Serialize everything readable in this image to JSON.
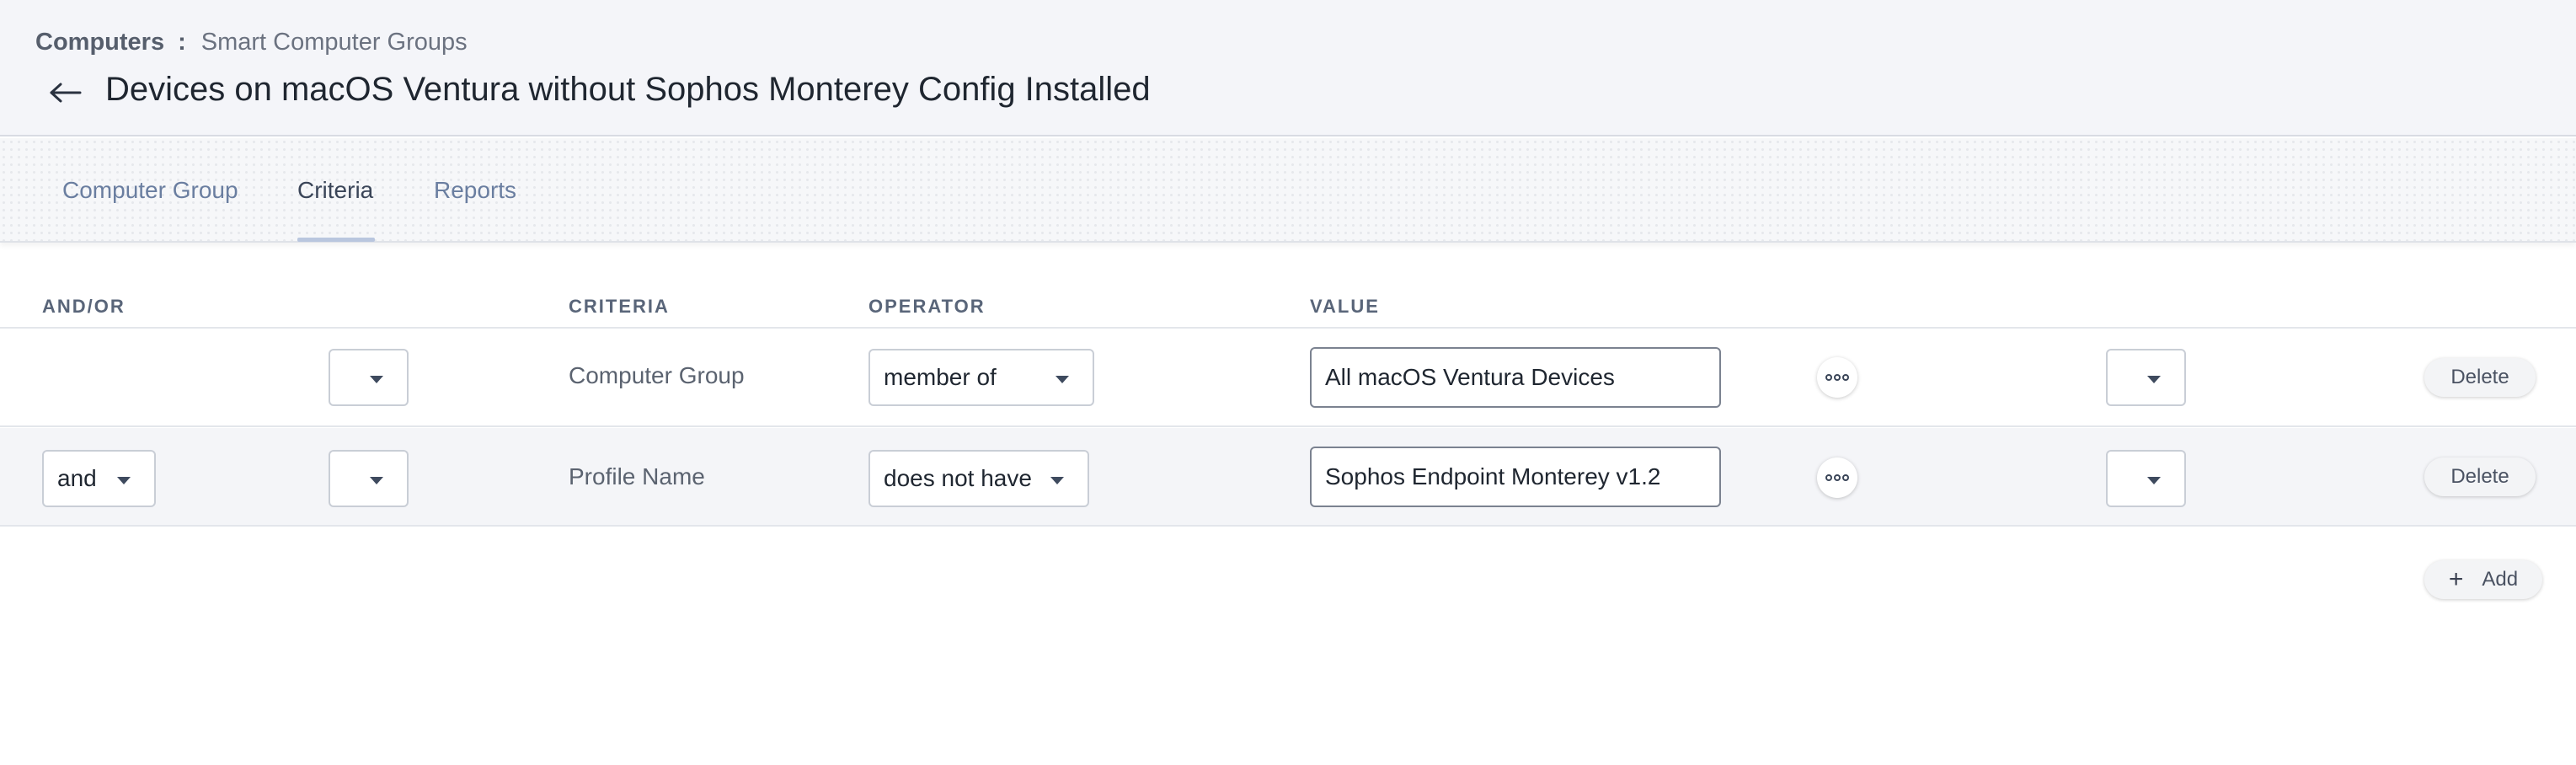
{
  "breadcrumb": {
    "root": "Computers",
    "separator": ":",
    "current": "Smart Computer Groups"
  },
  "page": {
    "title": "Devices on macOS Ventura without Sophos Monterey Config Installed",
    "back_icon": "arrow-left-icon"
  },
  "tabs": [
    {
      "label": "Computer Group",
      "active": false
    },
    {
      "label": "Criteria",
      "active": true
    },
    {
      "label": "Reports",
      "active": false
    }
  ],
  "columns": {
    "and_or": "AND/OR",
    "criteria": "CRITERIA",
    "operator": "OPERATOR",
    "value": "VALUE"
  },
  "rows": [
    {
      "and_or": "",
      "paren_open": "",
      "criteria": "Computer Group",
      "operator": "member of",
      "value": "All macOS Ventura Devices",
      "paren_close": "",
      "delete_label": "Delete"
    },
    {
      "and_or": "and",
      "paren_open": "",
      "criteria": "Profile Name",
      "operator": "does not have",
      "value": "Sophos Endpoint Monterey v1.2",
      "paren_close": "",
      "delete_label": "Delete"
    }
  ],
  "add_button": {
    "label": "Add",
    "icon": "plus-icon"
  },
  "colors": {
    "header_bg": "#f4f5f9",
    "tab_active_underline": "#b9c6de",
    "alt_row_bg": "#f4f5f8"
  }
}
